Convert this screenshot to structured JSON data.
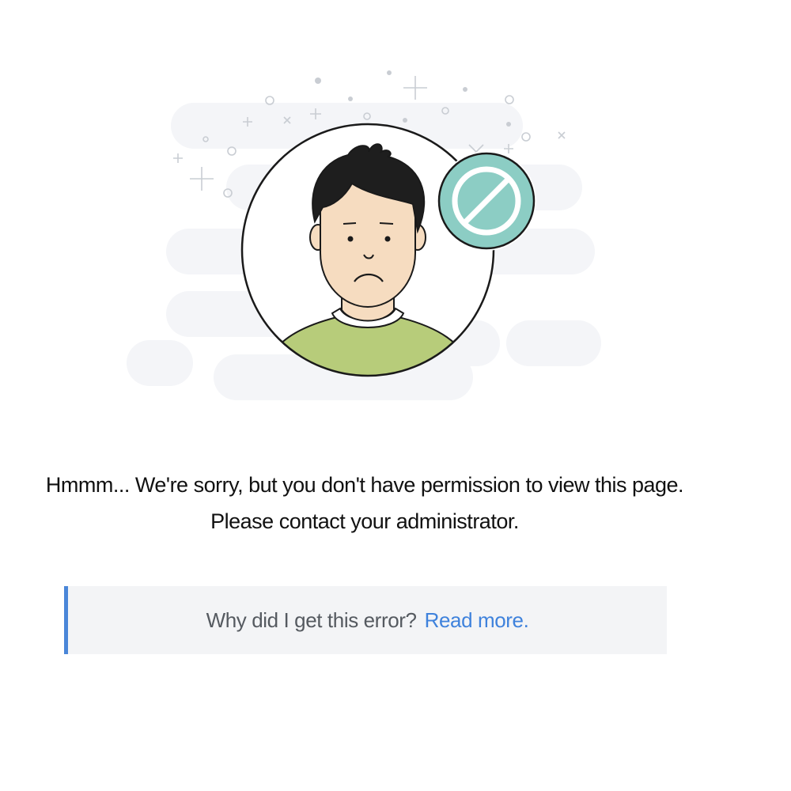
{
  "error": {
    "message": "Hmmm... We're sorry, but you don't have permission to view this page.",
    "instruction": "Please contact your administrator."
  },
  "help": {
    "question": "Why did I get this error?",
    "link_label": "Read more."
  },
  "colors": {
    "accent": "#4a86d8",
    "link": "#3f82dc",
    "badge": "#8ccdc4",
    "shirt": "#b7cc7a",
    "cloud": "#f4f5f8"
  },
  "icons": {
    "illustration": "sad-person-icon",
    "badge": "prohibited-icon"
  }
}
